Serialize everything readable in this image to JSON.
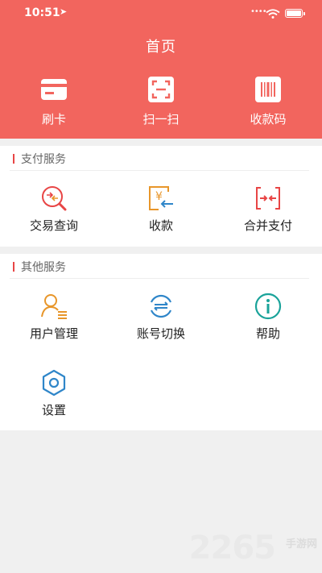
{
  "status_bar": {
    "time": "10:51",
    "location_glyph": "➤"
  },
  "header": {
    "title": "首页",
    "quick_actions": [
      {
        "label": "刷卡",
        "icon": "card-icon"
      },
      {
        "label": "扫一扫",
        "icon": "scan-icon"
      },
      {
        "label": "收款码",
        "icon": "barcode-icon"
      }
    ]
  },
  "payment_section": {
    "title": "支付服务",
    "items": [
      {
        "label": "交易查询",
        "icon": "transaction-search-icon"
      },
      {
        "label": "收款",
        "icon": "receive-payment-icon"
      },
      {
        "label": "合并支付",
        "icon": "merge-payment-icon"
      }
    ]
  },
  "other_section": {
    "title": "其他服务",
    "items": [
      {
        "label": "用户管理",
        "icon": "user-management-icon"
      },
      {
        "label": "账号切换",
        "icon": "account-switch-icon"
      },
      {
        "label": "帮助",
        "icon": "info-icon"
      },
      {
        "label": "设置",
        "icon": "gear-icon"
      }
    ]
  },
  "colors": {
    "header_bg": "#f2655e",
    "accent_red": "#e84545",
    "accent_orange": "#e8962a",
    "accent_blue": "#2f86c9",
    "accent_teal": "#1aa39a"
  },
  "watermark": {
    "number": "2265",
    "suffix": "手游网"
  }
}
